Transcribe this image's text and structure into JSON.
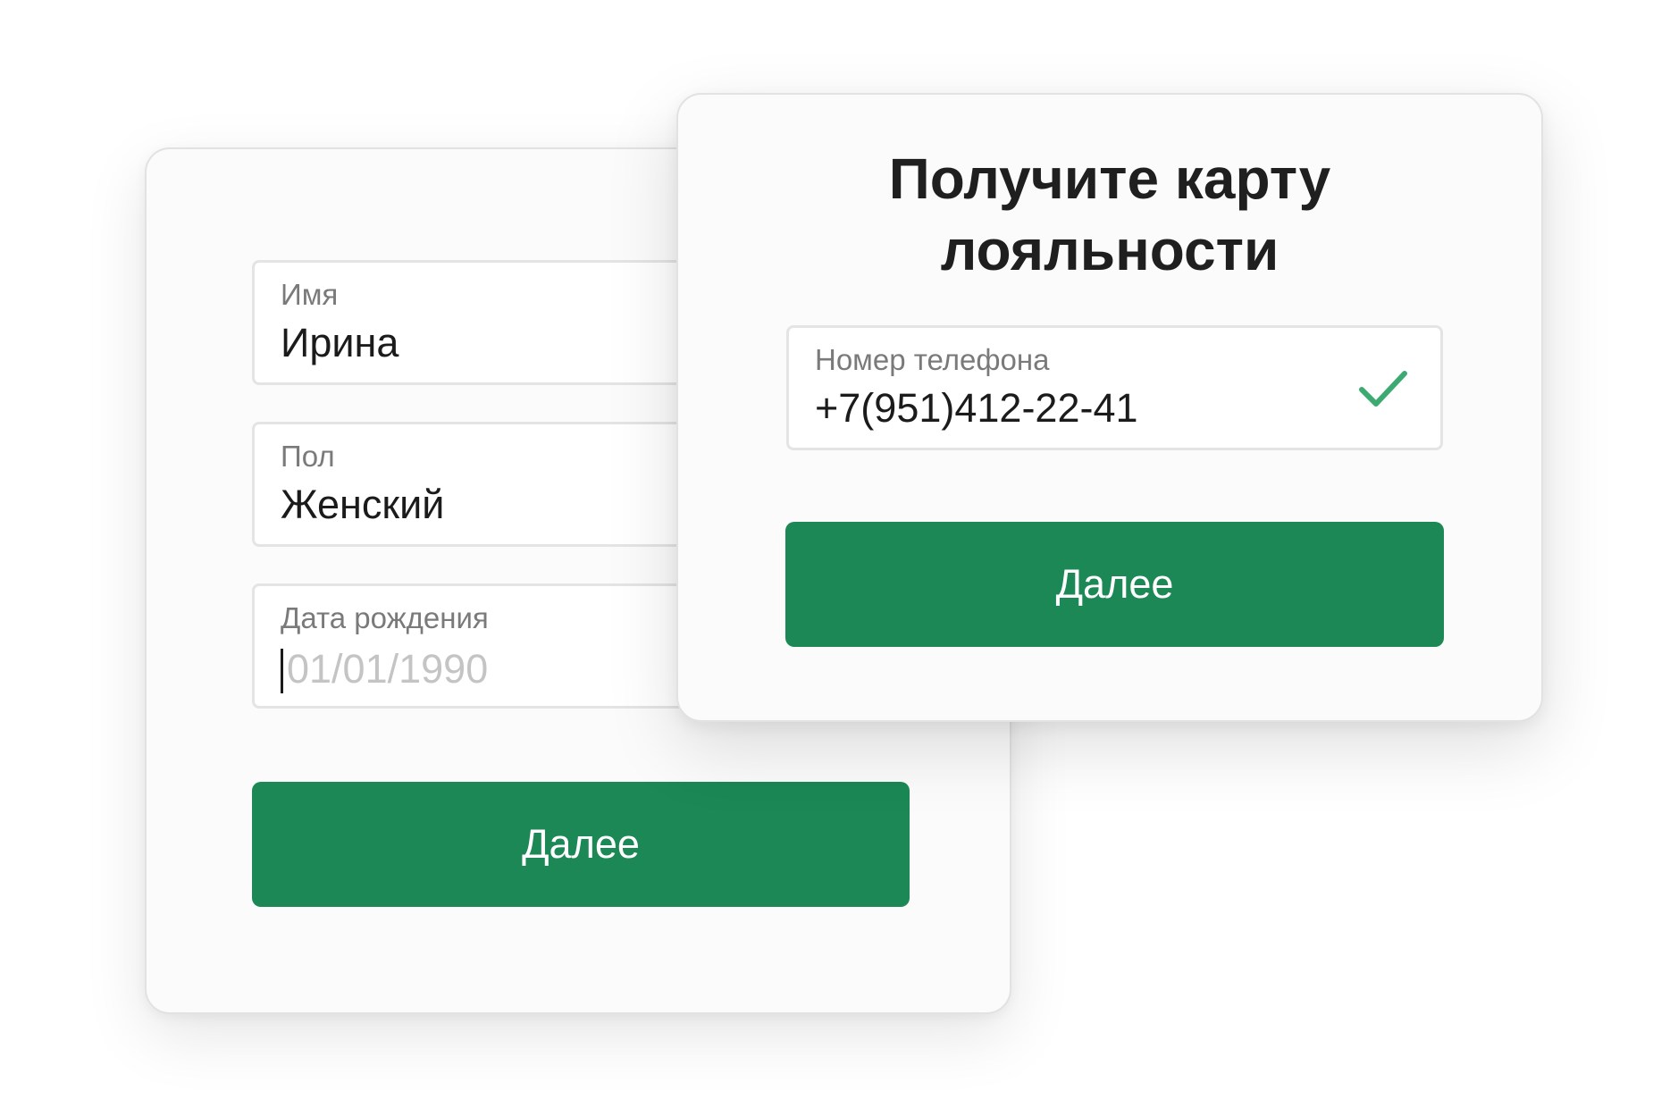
{
  "profile_form": {
    "name_field": {
      "label": "Имя",
      "value": "Ирина"
    },
    "gender_field": {
      "label": "Пол",
      "value": "Женский"
    },
    "birthdate_field": {
      "label": "Дата рождения",
      "placeholder": "01/01/1990"
    },
    "next_button": {
      "label": "Далее"
    }
  },
  "loyalty_form": {
    "title_line1": "Получите карту",
    "title_line2": "лояльности",
    "phone_field": {
      "label": "Номер телефона",
      "value": "+7(951)412-22-41",
      "status_icon": "check-icon"
    },
    "next_button": {
      "label": "Далее"
    }
  },
  "colors": {
    "accent": "#1b8855",
    "check": "#3daa72",
    "card_bg": "#fbfbfb",
    "card_border": "#e2e2e2"
  }
}
